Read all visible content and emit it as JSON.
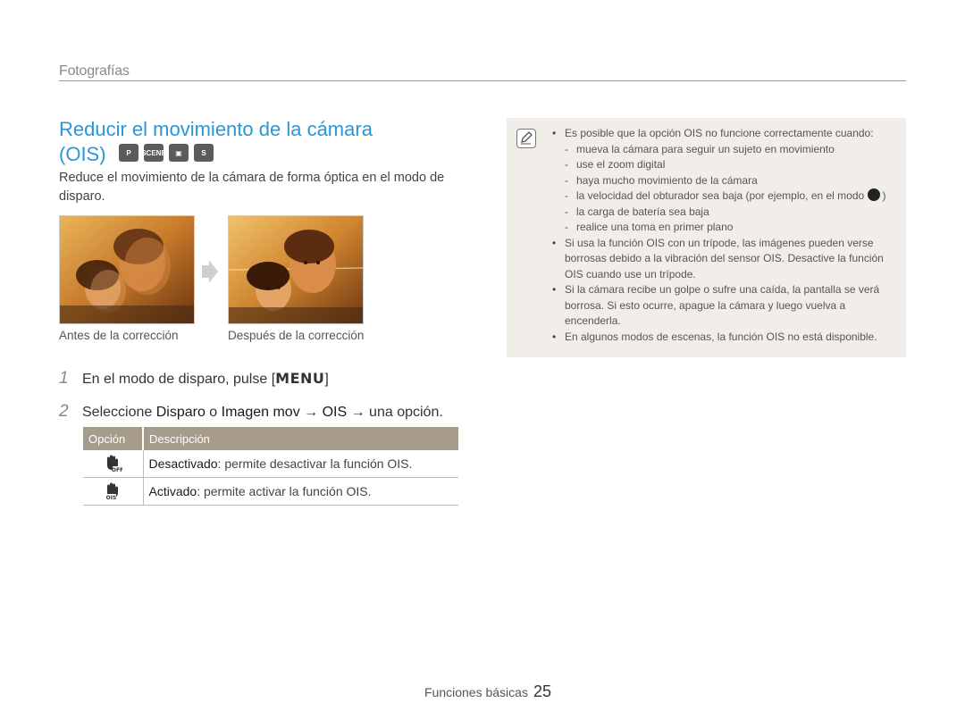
{
  "header": {
    "section": "Fotografías"
  },
  "title": {
    "line1": "Reducir el movimiento de la cámara",
    "line2": "(OIS)"
  },
  "mode_icons": [
    {
      "name": "program-mode-icon",
      "label": "P"
    },
    {
      "name": "scene-mode-icon",
      "label": "SCENE"
    },
    {
      "name": "movie-mode-icon",
      "label": "▣"
    },
    {
      "name": "smart-movie-mode-icon",
      "label": "S"
    }
  ],
  "intro": "Reduce el movimiento de la cámara de forma óptica en el modo de disparo.",
  "photos": {
    "before_caption": "Antes de la corrección",
    "after_caption": "Después de la corrección"
  },
  "steps": {
    "step1_num": "1",
    "step1_text": "En el modo de disparo, pulse [",
    "step1_key": "MENU",
    "step1_end": "]",
    "step2_num": "2",
    "step2_a": "Seleccione ",
    "step2_b": "Disparo",
    "step2_c": " o ",
    "step2_d": "Imagen mov",
    "step2_e": " → ",
    "step2_f": "OIS",
    "step2_g": " → una opción."
  },
  "table": {
    "col_option": "Opción",
    "col_desc": "Descripción",
    "rows": [
      {
        "icon": "ois-off-icon",
        "name": "Desactivado",
        "desc": ": permite desactivar la función OIS."
      },
      {
        "icon": "ois-on-icon",
        "name": "Activado",
        "desc": ": permite activar la función OIS."
      }
    ]
  },
  "notes": {
    "b1": "Es posible que la opción OIS no funcione correctamente cuando:",
    "d1": "mueva la cámara para seguir un sujeto en movimiento",
    "d2": "use el zoom digital",
    "d3": "haya mucho movimiento de la cámara",
    "d4": "la velocidad del obturador sea baja (por ejemplo, en el modo",
    "d4_end": ")",
    "d5": "la carga de batería sea baja",
    "d6": "realice una toma en primer plano",
    "b2": "Si usa la función OIS con un trípode, las imágenes pueden verse borrosas debido a la vibración del sensor OIS. Desactive la función OIS cuando use un trípode.",
    "b3": "Si la cámara recibe un golpe o sufre una caída, la pantalla se verá borrosa. Si esto ocurre, apague la cámara y luego vuelva a encenderla.",
    "b4": "En algunos modos de escenas, la función OIS no está disponible."
  },
  "footer": {
    "label": "Funciones básicas",
    "page": "25"
  },
  "colors": {
    "title": "#2996d9",
    "table_header": "#a79c8b",
    "note_bg": "#f1eeea"
  }
}
